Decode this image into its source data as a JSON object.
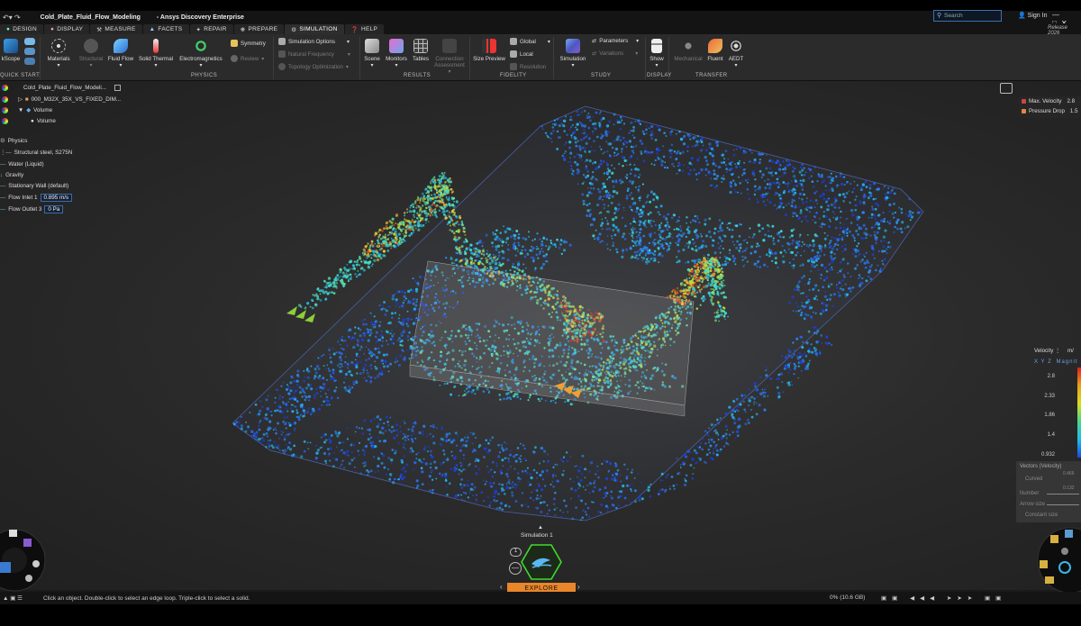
{
  "window": {
    "title": "Cold_Plate_Fluid_Flow_Modeling",
    "app": "- Ansys Discovery Enterprise",
    "search_placeholder": "Search",
    "signin": "Sign In",
    "release": "Release 2026"
  },
  "tabs": [
    {
      "label": "DESIGN"
    },
    {
      "label": "DISPLAY"
    },
    {
      "label": "MEASURE"
    },
    {
      "label": "FACETS"
    },
    {
      "label": "REPAIR"
    },
    {
      "label": "PREPARE"
    },
    {
      "label": "SIMULATION",
      "active": true
    },
    {
      "label": "HELP"
    }
  ],
  "ribbon": {
    "quickscope": "kScope",
    "materials": "Materials",
    "structural": "Structural",
    "fluid_flow": "Fluid Flow",
    "solid_thermal": "Solid Thermal",
    "electromagnetics": "Electromagnetics",
    "symmetry": "Symmetry",
    "review": "Review",
    "simulation_options": "Simulation Options",
    "natural_frequency": "Natural Frequency",
    "topology_optimization": "Topology Optimization",
    "scene": "Scene",
    "monitors": "Monitors",
    "tables": "Tables",
    "connection_assessment": "Connection Assessment",
    "size_preview": "Size Preview",
    "global": "Global",
    "local": "Local",
    "resolution": "Resolution",
    "simulation": "Simulation",
    "parameters": "Parameters",
    "variations": "Variations",
    "show": "Show",
    "mechanical": "Mechanical",
    "fluent": "Fluent",
    "aedt": "AEDT",
    "groups": {
      "quick_start": "QUICK START",
      "physics": "PHYSICS",
      "results": "RESULTS",
      "fidelity": "FIDELITY",
      "study": "STUDY",
      "display": "DISPLAY",
      "transfer": "TRANSFER"
    }
  },
  "tree": {
    "root": "Cold_Plate_Fluid_Flow_Modeli...",
    "part": "000_M32X_35X_VS_FIXED_DIM...",
    "volume_group": "Volume",
    "volume": "Volume",
    "physics": "Physics",
    "material": "Structural steel, S275N",
    "fluid": "Water (Liquid)",
    "gravity": "Gravity",
    "wall": "Stationary Wall (default)",
    "inlet_label": "Flow Inlet 1",
    "inlet_value": "0.895 m/s",
    "outlet_label": "Flow Outlet 3",
    "outlet_value": "0 Pa"
  },
  "monitors": {
    "max_velocity_label": "Max. Velocity",
    "max_velocity_value": "2.8",
    "pressure_drop_label": "Pressure Drop",
    "pressure_drop_value": "1.5"
  },
  "legend": {
    "title": "Velocity",
    "unit": "m/",
    "axes": "X Y Z",
    "mode": "Magnit",
    "ticks": [
      "2.8",
      "2.33",
      "1.86",
      "1.4",
      "0.932"
    ],
    "colors": [
      "#e41b1b",
      "#e8a21b",
      "#d8e01b",
      "#49d88a",
      "#1bc0e6",
      "#1b4ae6"
    ]
  },
  "vectors_panel": {
    "title": "Vectors (Velocity)",
    "curved": "Curved",
    "number": "Number",
    "arrow_size": "Arrow size",
    "constant_size": "Constant size",
    "value_a": "0.466",
    "value_b": "0.132"
  },
  "bottom": {
    "simulation_label": "Simulation 1",
    "explore": "EXPLORE",
    "study_count": "1",
    "status_message": "Click an object. Double-click to select an edge loop. Triple-click to select a solid.",
    "memory": "0% (10.6 GB)"
  }
}
